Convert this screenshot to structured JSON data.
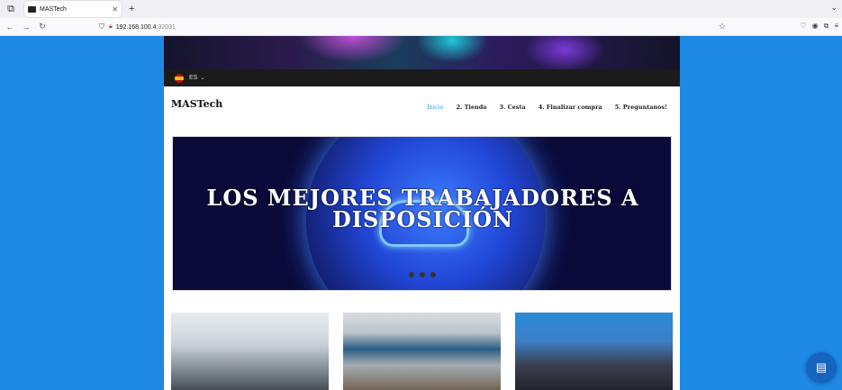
{
  "browser": {
    "tab_title": "MASTech",
    "url_host": "192.168.100.4",
    "url_port": ":32031"
  },
  "lang": {
    "code": "ES"
  },
  "site": {
    "brand": "MASTech",
    "menu": [
      {
        "label": "Inicio",
        "active": true
      },
      {
        "label": "2. Tienda"
      },
      {
        "label": "3. Cesta"
      },
      {
        "label": "4. Finalizar compra"
      },
      {
        "label": "5. Preguntanos!"
      }
    ]
  },
  "slider": {
    "caption": "LOS MEJORES TRABAJADORES A DISPOSICIÓN",
    "slide_count": 3
  },
  "colors": {
    "accent": "#1ea0d8",
    "background": "#1e88e5",
    "chat": "#1565c0"
  }
}
